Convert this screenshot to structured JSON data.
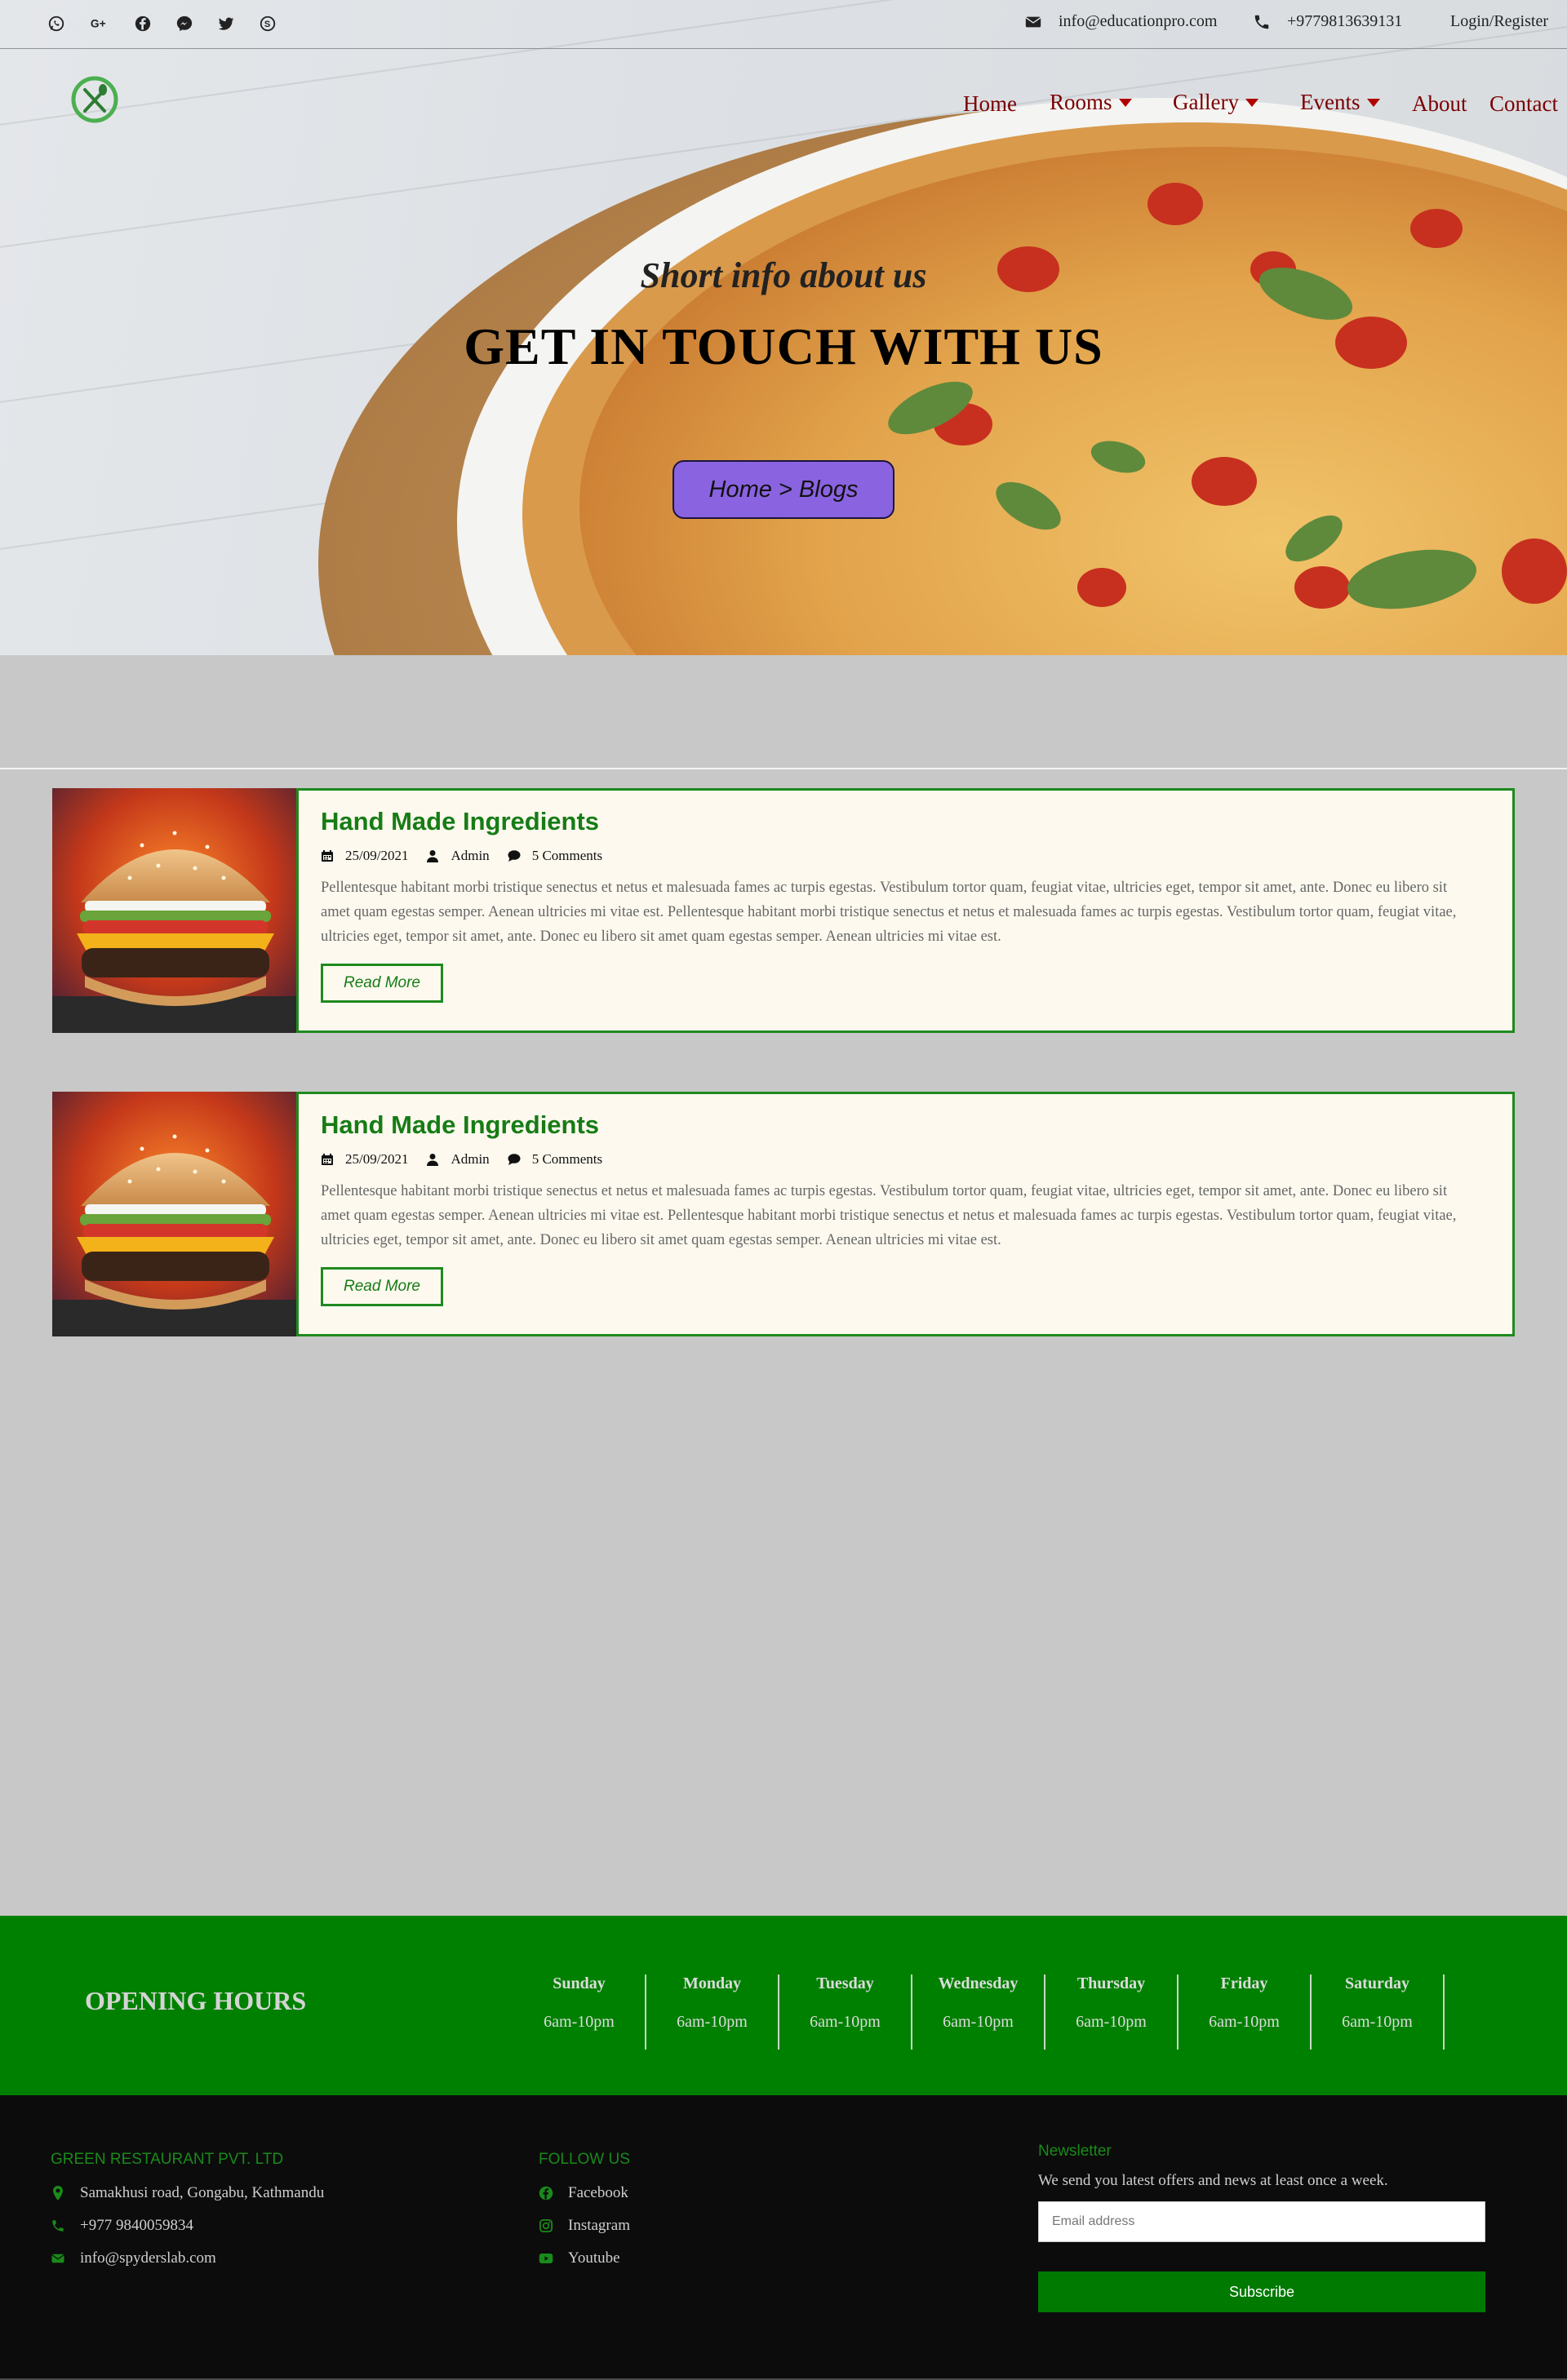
{
  "topbar": {
    "socials": [
      {
        "icon": "whatsapp-icon"
      },
      {
        "icon": "google-plus-icon"
      },
      {
        "icon": "facebook-icon"
      },
      {
        "icon": "messenger-icon"
      },
      {
        "icon": "twitter-icon"
      },
      {
        "icon": "skype-icon"
      }
    ],
    "email": "info@educationpro.com",
    "phone": "+9779813639131",
    "login": "Login/Register"
  },
  "nav": {
    "logo_icon": "restaurant-fork-knife-logo",
    "items": [
      {
        "label": "Home",
        "dropdown": false
      },
      {
        "label": "Rooms",
        "dropdown": true
      },
      {
        "label": "Gallery",
        "dropdown": true
      },
      {
        "label": "Events",
        "dropdown": true
      },
      {
        "label": "About",
        "dropdown": false
      },
      {
        "label": "Contact",
        "dropdown": false
      }
    ]
  },
  "hero": {
    "subtitle": "Short info about us",
    "title": "GET IN TOUCH WITH US",
    "breadcrumb": "Home > Blogs"
  },
  "posts": [
    {
      "title": "Hand Made Ingredients",
      "date": "25/09/2021",
      "author": "Admin",
      "comments": "5 Comments",
      "excerpt": "Pellentesque habitant morbi tristique senectus et netus et malesuada fames ac turpis egestas. Vestibulum tortor quam, feugiat vitae, ultricies eget, tempor sit amet, ante. Donec eu libero sit amet quam egestas semper. Aenean ultricies mi vitae est. Pellentesque habitant morbi tristique senectus et netus et malesuada fames ac turpis egestas. Vestibulum tortor quam, feugiat vitae, ultricies eget, tempor sit amet, ante. Donec eu libero sit amet quam egestas semper. Aenean ultricies mi vitae est.",
      "read_more": "Read More"
    },
    {
      "title": "Hand Made Ingredients",
      "date": "25/09/2021",
      "author": "Admin",
      "comments": "5 Comments",
      "excerpt": "Pellentesque habitant morbi tristique senectus et netus et malesuada fames ac turpis egestas. Vestibulum tortor quam, feugiat vitae, ultricies eget, tempor sit amet, ante. Donec eu libero sit amet quam egestas semper. Aenean ultricies mi vitae est. Pellentesque habitant morbi tristique senectus et netus et malesuada fames ac turpis egestas. Vestibulum tortor quam, feugiat vitae, ultricies eget, tempor sit amet, ante. Donec eu libero sit amet quam egestas semper. Aenean ultricies mi vitae est.",
      "read_more": "Read More"
    }
  ],
  "hours": {
    "title": "OPENING HOURS",
    "days": [
      {
        "name": "Sunday",
        "time": "6am-10pm"
      },
      {
        "name": "Monday",
        "time": "6am-10pm"
      },
      {
        "name": "Tuesday",
        "time": "6am-10pm"
      },
      {
        "name": "Wednesday",
        "time": "6am-10pm"
      },
      {
        "name": "Thursday",
        "time": "6am-10pm"
      },
      {
        "name": "Friday",
        "time": "6am-10pm"
      },
      {
        "name": "Saturday",
        "time": "6am-10pm"
      }
    ]
  },
  "footer": {
    "company": {
      "heading": "GREEN RESTAURANT PVT. LTD",
      "address": "Samakhusi road, Gongabu, Kathmandu",
      "phone": "+977 9840059834",
      "email": "info@spyderslab.com"
    },
    "follow": {
      "heading": "FOLLOW US",
      "links": [
        "Facebook",
        "Instagram",
        "Youtube"
      ]
    },
    "newsletter": {
      "heading": "Newsletter",
      "text": "We send you latest offers and news at least once a week.",
      "placeholder": "Email address",
      "button": "Subscribe"
    }
  },
  "colors": {
    "brand_green": "#008000",
    "nav_red": "#7a0000",
    "breadcrumb_purple": "#8a63e0",
    "footer_bg": "#0c0c0c"
  }
}
